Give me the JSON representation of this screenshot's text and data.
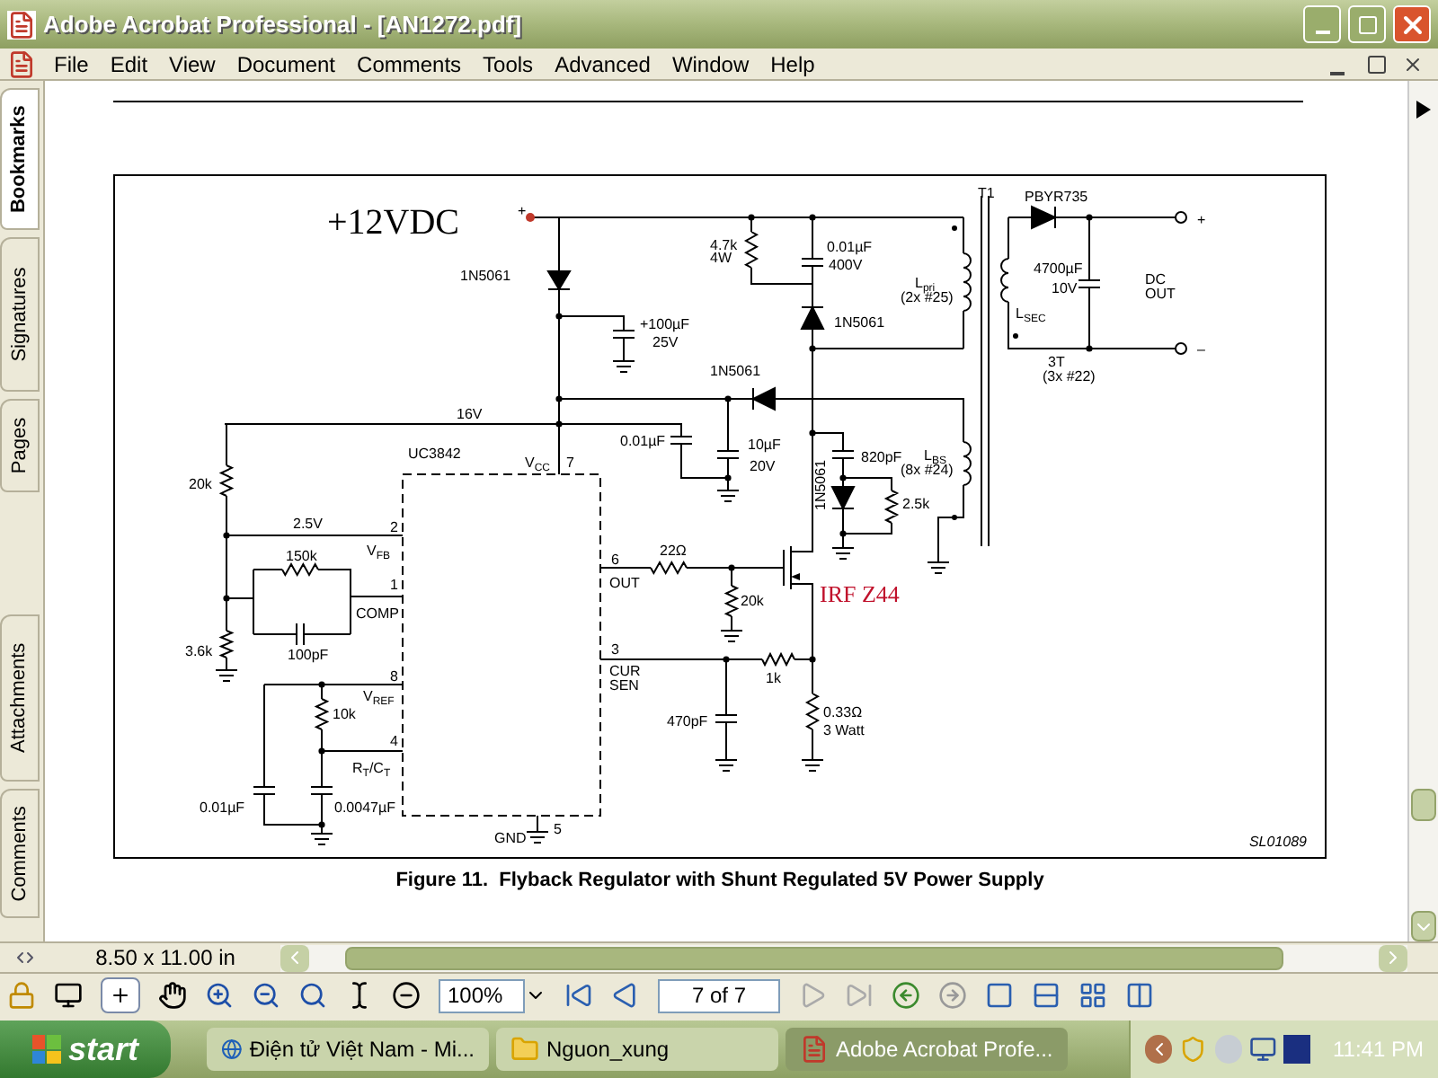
{
  "window": {
    "title": "Adobe Acrobat Professional - [AN1272.pdf]"
  },
  "menu": [
    "File",
    "Edit",
    "View",
    "Document",
    "Comments",
    "Tools",
    "Advanced",
    "Window",
    "Help"
  ],
  "side_tabs": [
    {
      "label": "Bookmarks",
      "selected": true
    },
    {
      "label": "Signatures",
      "selected": false
    },
    {
      "label": "Pages",
      "selected": false
    },
    {
      "label": "Attachments",
      "selected": false
    },
    {
      "label": "Comments",
      "selected": false
    }
  ],
  "figure": {
    "supply_label": "+12VDC",
    "transistor_label": "IRF Z44",
    "drawing_id": "SL01089",
    "caption": "Figure 11.  Flyback Regulator with Shunt Regulated 5V Power Supply",
    "labels": [
      "+",
      "1N5061",
      "+100µF",
      "25V",
      "4.7k",
      "4W",
      "0.01µF",
      "400V",
      "1N5061",
      "T1",
      "PBYR735",
      "L$_{pri}$",
      "(2x #25)",
      "4700µF",
      "10V",
      "L$_{SEC}$",
      "DC",
      "OUT",
      "+",
      "–",
      "3T",
      "(3x #22)",
      "1N5061",
      "16V",
      "0.01µF",
      "10µF",
      "20V",
      "820pF",
      "L$_{BS}$",
      "(8x #24)",
      "1N5061",
      "2.5k",
      "UC3842",
      "V$_{CC}$",
      "7",
      "20k",
      "2.5V",
      "2",
      "150k",
      "V$_{FB}$",
      "1",
      "COMP",
      "6",
      "OUT",
      "22Ω",
      "20k",
      "3.6k",
      "100pF",
      "3",
      "CUR",
      "SEN",
      "8",
      "1k",
      "V$_{REF}$",
      "10k",
      "470pF",
      "0.33Ω",
      "3 Watt",
      "4",
      "R$_{T}$/C$_{T}$",
      "0.01µF",
      "0.0047µF",
      "GND",
      "5"
    ]
  },
  "page_size": "8.50 x 11.00 in",
  "toolbar": {
    "zoom": "100%",
    "page": "7 of 7"
  },
  "taskbar": {
    "start": "start",
    "tasks": [
      {
        "label": "Điện tử Việt Nam - Mi...",
        "kind": "browser",
        "selected": false
      },
      {
        "label": "Nguon_xung",
        "kind": "folder",
        "selected": false
      },
      {
        "label": "Adobe Acrobat Profe...",
        "kind": "pdf",
        "selected": true
      }
    ],
    "clock": "11:41 PM"
  }
}
